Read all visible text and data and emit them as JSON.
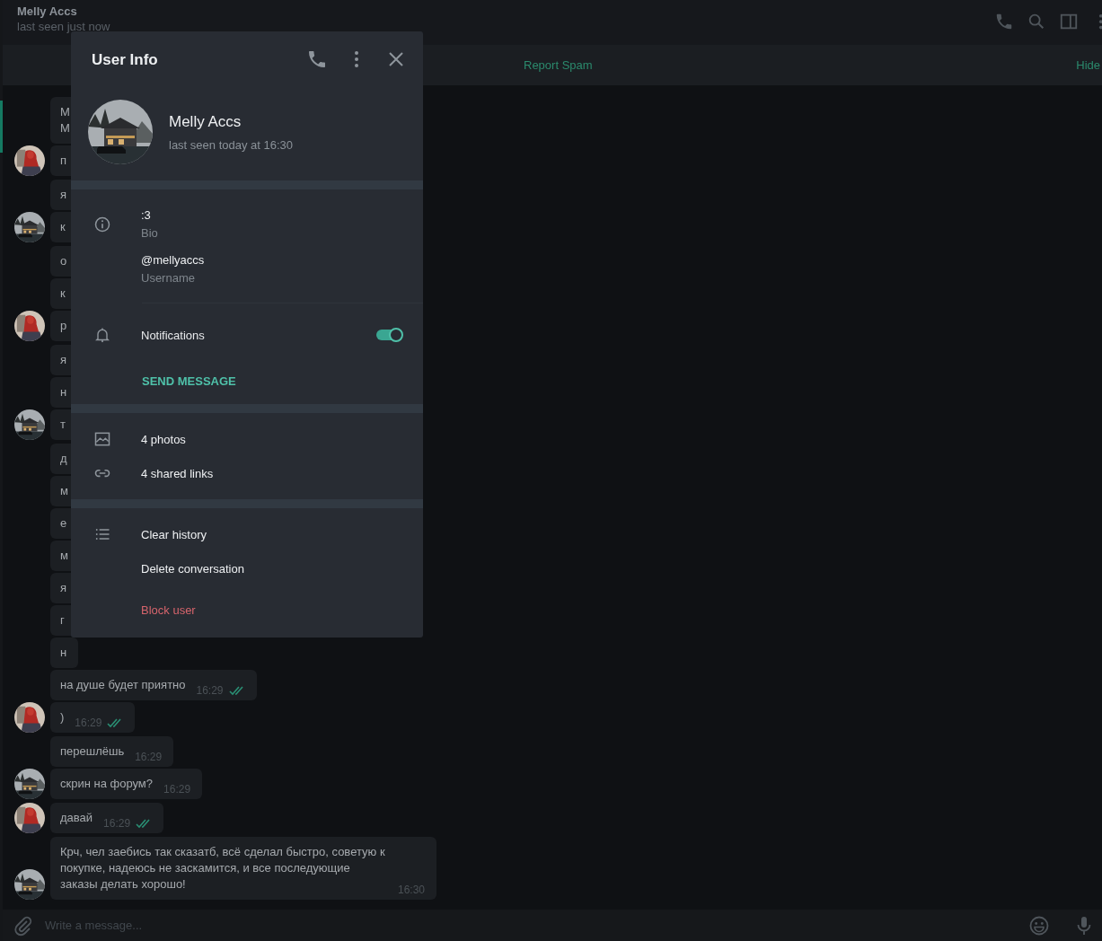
{
  "chat_header": {
    "title": "Melly Accs",
    "status": "last seen just now"
  },
  "action_bar": {
    "report": "Report Spam",
    "hide": "Hide"
  },
  "message_groups": [
    {
      "kind": "self",
      "messages": [
        {
          "text": "М\nМ"
        },
        {
          "text": "п"
        }
      ]
    },
    {
      "kind": "other",
      "messages": [
        {
          "text": "я"
        },
        {
          "text": "к"
        }
      ]
    },
    {
      "kind": "self",
      "messages": [
        {
          "text": "о"
        },
        {
          "text": "к"
        },
        {
          "text": "р"
        }
      ]
    },
    {
      "kind": "other",
      "messages": [
        {
          "text": "я"
        },
        {
          "text": "н"
        },
        {
          "text": "т"
        }
      ]
    },
    {
      "kind": "self",
      "messages": [
        {
          "text": "д"
        },
        {
          "text": "м"
        },
        {
          "text": "е"
        },
        {
          "text": "м"
        },
        {
          "text": "я"
        },
        {
          "text": "г"
        },
        {
          "text": "н"
        },
        {
          "text": "на душе будет приятно",
          "time": "16:29",
          "read": true
        },
        {
          "text": ")",
          "time": "16:29",
          "read": true
        }
      ]
    },
    {
      "kind": "other",
      "messages": [
        {
          "text": "перешлёшь",
          "time": "16:29"
        },
        {
          "text": "скрин на форум?",
          "time": "16:29"
        }
      ]
    },
    {
      "kind": "self",
      "messages": [
        {
          "text": "давай",
          "time": "16:29",
          "read": true
        }
      ]
    },
    {
      "kind": "other",
      "messages": [
        {
          "text": "Крч, чел заебись так сказатб, всё сделал быстро, советую к покупке, надеюсь не заскамится, и все последующие заказы делать хорошо!",
          "time": "16:30"
        }
      ]
    }
  ],
  "composer": {
    "placeholder": "Write a message..."
  },
  "user_info": {
    "title": "User Info",
    "name": "Melly Accs",
    "status": "last seen today at 16:30",
    "info": [
      {
        "value": ":3",
        "label": "Bio"
      },
      {
        "value": "@mellyaccs",
        "label": "Username"
      }
    ],
    "notifications": {
      "label": "Notifications",
      "on": true
    },
    "send_message": "SEND MESSAGE",
    "media": [
      {
        "kind": "photos",
        "label": "4 photos"
      },
      {
        "kind": "links",
        "label": "4 shared links"
      }
    ],
    "actions": [
      {
        "kind": "history",
        "label": "Clear history"
      },
      {
        "kind": "delete",
        "label": "Delete conversation"
      },
      {
        "kind": "block",
        "label": "Block user"
      }
    ]
  }
}
